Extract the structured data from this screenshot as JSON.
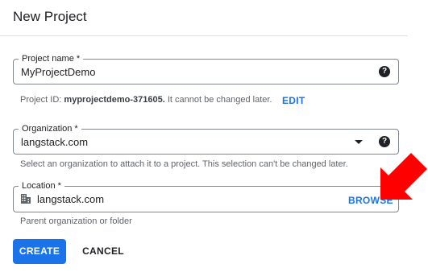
{
  "dialog": {
    "title": "New Project"
  },
  "project_name": {
    "label": "Project name *",
    "value": "MyProjectDemo",
    "help_icon": "help-icon"
  },
  "project_id": {
    "prefix": "Project ID:",
    "id": "myprojectdemo-371605.",
    "suffix": "It cannot be changed later.",
    "edit_label": "EDIT"
  },
  "organization": {
    "label": "Organization *",
    "value": "langstack.com",
    "dropdown_icon": "chevron-down-icon",
    "help_icon": "help-icon",
    "helper_text": "Select an organization to attach it to a project. This selection can't be changed later."
  },
  "location": {
    "label": "Location *",
    "value": "langstack.com",
    "icon": "building-icon",
    "browse_label": "BROWSE",
    "helper_text": "Parent organization or folder"
  },
  "annotation": {
    "arrow_color": "#ff0000"
  },
  "actions": {
    "create_label": "CREATE",
    "cancel_label": "CANCEL"
  },
  "colors": {
    "primary": "#1a73e8",
    "text": "#202124",
    "muted": "#5f6368"
  }
}
